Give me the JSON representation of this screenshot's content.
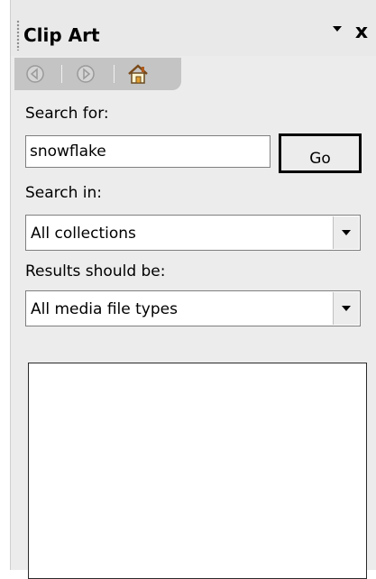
{
  "pane": {
    "title": "Clip Art",
    "menu_icon": "down-triangle-icon",
    "close_label": "x"
  },
  "nav": {
    "back_icon": "back-arrow-icon",
    "forward_icon": "forward-arrow-icon",
    "home_icon": "home-icon"
  },
  "search": {
    "label": "Search for:",
    "value": "snowflake",
    "go_label": "Go"
  },
  "search_in": {
    "label": "Search in:",
    "value": "All collections"
  },
  "results_type": {
    "label": "Results should be:",
    "value": "All media file types"
  }
}
